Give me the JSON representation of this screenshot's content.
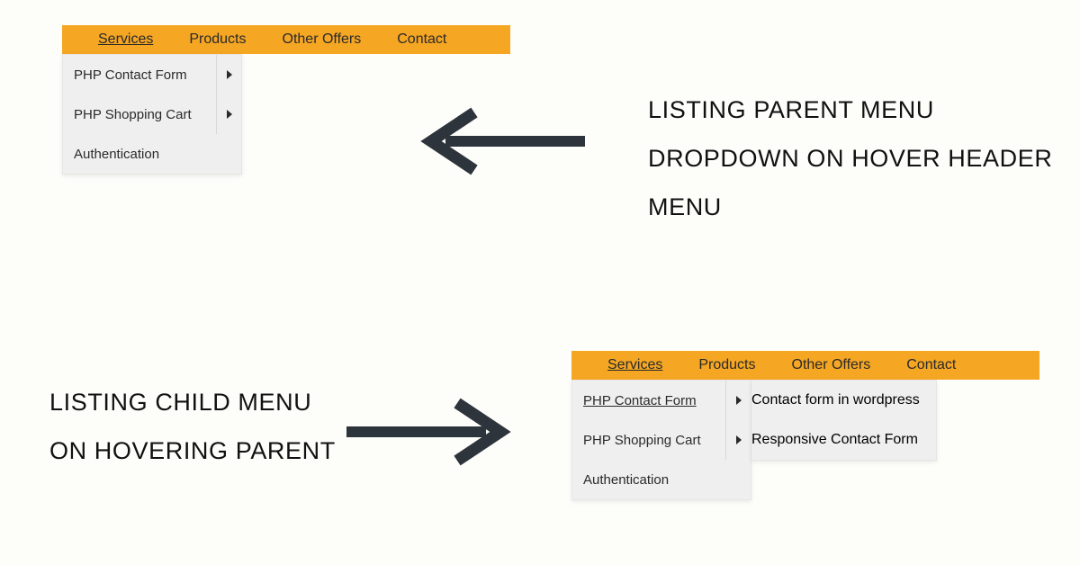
{
  "captions": {
    "top": "Listing parent menu dropdown on hover header menu",
    "bottom": "Listing child menu on hovering parent"
  },
  "menu": {
    "items": [
      "Services",
      "Products",
      "Other Offers",
      "Contact"
    ],
    "active": "Services"
  },
  "dropdown": {
    "items": [
      {
        "label": "PHP Contact Form",
        "has_children": true
      },
      {
        "label": "PHP Shopping Cart",
        "has_children": true
      },
      {
        "label": "Authentication",
        "has_children": false
      }
    ],
    "active_parent": "PHP Contact Form"
  },
  "submenu": {
    "items": [
      "Contact form in wordpress",
      "Responsive Contact Form"
    ]
  },
  "colors": {
    "menu_bg": "#f5a623",
    "dropdown_bg": "#efefef",
    "arrow": "#2e343c"
  }
}
